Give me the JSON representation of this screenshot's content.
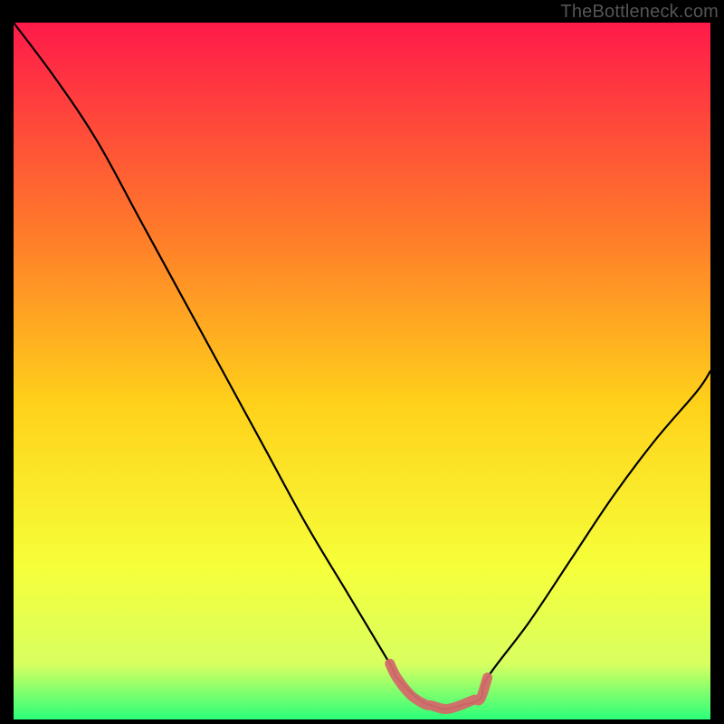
{
  "watermark": "TheBottleneck.com",
  "colors": {
    "bg": "#000000",
    "grad_top": "#ff1a4a",
    "grad_upper_mid": "#ff7a2a",
    "grad_mid": "#ffd21a",
    "grad_lower_mid": "#f6ff3a",
    "grad_near_bottom": "#d8ff60",
    "grad_bottom": "#2bff7a",
    "curve": "#000000",
    "highlight": "#d46a6a"
  },
  "chart_data": {
    "type": "line",
    "title": "",
    "xlabel": "",
    "ylabel": "",
    "xlim": [
      0,
      100
    ],
    "ylim": [
      0,
      100
    ],
    "series": [
      {
        "name": "bottleneck-curve",
        "x": [
          0,
          6,
          12,
          18,
          24,
          30,
          36,
          42,
          48,
          54,
          55,
          58,
          60,
          62,
          64,
          67,
          68,
          74,
          80,
          86,
          92,
          98,
          100
        ],
        "y": [
          100,
          92,
          83,
          72,
          61,
          50,
          39,
          28,
          18,
          8,
          6,
          3,
          2,
          1.5,
          2,
          3,
          6,
          14,
          23,
          32,
          40,
          47,
          50
        ]
      },
      {
        "name": "sweet-spot-highlight",
        "x": [
          54,
          55,
          57,
          59,
          60,
          62,
          64,
          66,
          67,
          68
        ],
        "y": [
          8,
          6,
          3.5,
          2.2,
          2,
          1.5,
          2,
          2.8,
          3,
          6
        ]
      }
    ]
  }
}
